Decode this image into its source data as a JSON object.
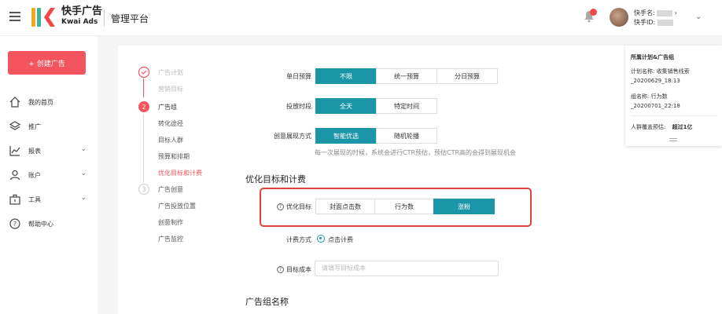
{
  "header": {
    "brand_cn": "快手广告",
    "brand_en": "Kwai Ads",
    "platform": "管理平台",
    "user_name_label": "快手名:",
    "user_id_label": "快手ID:",
    "user_name_suffix": "›"
  },
  "sidebar": {
    "create_label": "+ 创建广告",
    "items": [
      {
        "label": "我的首页",
        "icon": "home-icon"
      },
      {
        "label": "推广",
        "icon": "layers-icon"
      },
      {
        "label": "报表",
        "icon": "chart-icon"
      },
      {
        "label": "账户",
        "icon": "user-icon"
      },
      {
        "label": "工具",
        "icon": "toolbox-icon"
      },
      {
        "label": "帮助中心",
        "icon": "help-icon"
      }
    ]
  },
  "steps": {
    "step1": {
      "label": "广告计划",
      "sub": [
        "营销目标"
      ]
    },
    "step2": {
      "num": "2",
      "label": "广告组",
      "sub": [
        "转化途径",
        "目标人群",
        "预算和排期",
        "优化目标和计费"
      ]
    },
    "step3": {
      "num": "3",
      "label": "广告创意",
      "sub": [
        "广告投放位置",
        "创意制作",
        "广告监控"
      ]
    }
  },
  "form": {
    "budget": {
      "label": "单日预算",
      "options": [
        "不限",
        "统一预算",
        "分日预算"
      ]
    },
    "period": {
      "label": "投放时段",
      "options": [
        "全天",
        "特定时间"
      ]
    },
    "display": {
      "label": "创意展现方式",
      "options": [
        "智能优选",
        "随机轮播"
      ],
      "hint": "每一次展现的时候，系统会进行CTR预估，预估CTR高的会得到展现机会"
    },
    "section_title": "优化目标和计费",
    "goal": {
      "label": "优化目标",
      "options": [
        "封面点击数",
        "行为数",
        "涨粉"
      ]
    },
    "billing": {
      "label": "计费方式",
      "value": "点击计费"
    },
    "cost": {
      "label": "目标成本",
      "placeholder": "请填写目标成本"
    },
    "group_name_title": "广告组名称"
  },
  "panel": {
    "title": "所属计划&广告组",
    "plan_label": "计划名称:",
    "plan_value": "收集销售线索",
    "plan_value2": "_20200629_18:13",
    "group_label": "组名称:",
    "group_value": "行为数",
    "group_value2": "_20200701_22:18",
    "coverage_label": "人群覆盖预估:",
    "coverage_value": "超过1亿"
  },
  "colors": {
    "accent": "#1a96a8",
    "brand_red": "#f3545d",
    "highlight": "#d9453a"
  }
}
